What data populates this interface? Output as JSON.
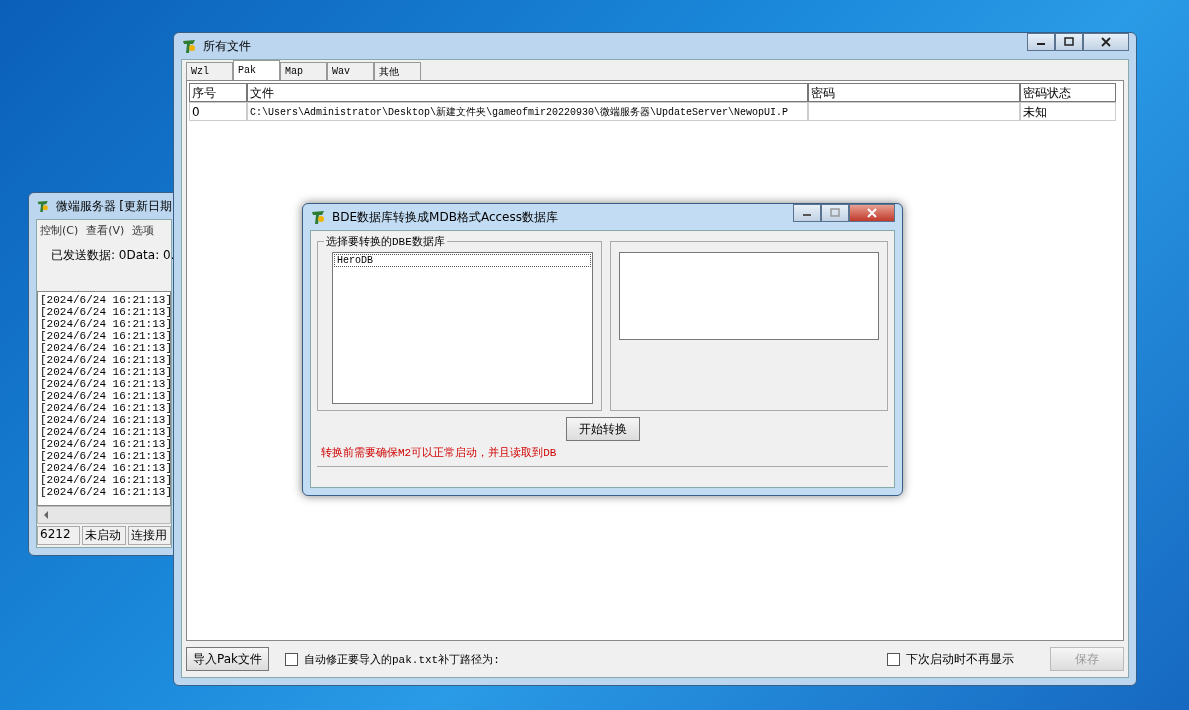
{
  "back_window": {
    "title": "微端服务器 [更新日期",
    "menu": [
      {
        "label": "控制(C)"
      },
      {
        "label": "查看(V)"
      },
      {
        "label": "选项"
      }
    ],
    "sent_data": "已发送数据: 0Data: 0.",
    "log": [
      "[2024/6/24 16:21:13]",
      "[2024/6/24 16:21:13]",
      "[2024/6/24 16:21:13]",
      "[2024/6/24 16:21:13]",
      "[2024/6/24 16:21:13]",
      "[2024/6/24 16:21:13]",
      "[2024/6/24 16:21:13]",
      "[2024/6/24 16:21:13]",
      "[2024/6/24 16:21:13]",
      "[2024/6/24 16:21:13]",
      "[2024/6/24 16:21:13]",
      "[2024/6/24 16:21:13]",
      "[2024/6/24 16:21:13]",
      "[2024/6/24 16:21:13]",
      "[2024/6/24 16:21:13]",
      "[2024/6/24 16:21:13]",
      "[2024/6/24 16:21:13]"
    ],
    "status": [
      "6212",
      "未启动",
      "连接用"
    ]
  },
  "main_window": {
    "title": "所有文件",
    "tabs": [
      {
        "label": "Wzl",
        "selected": false
      },
      {
        "label": "Pak",
        "selected": true
      },
      {
        "label": "Map",
        "selected": false
      },
      {
        "label": "Wav",
        "selected": false
      },
      {
        "label": "其他",
        "selected": false
      }
    ],
    "table": {
      "columns": [
        "序号",
        "文件",
        "密码",
        "密码状态"
      ],
      "rows": [
        {
          "index": "0",
          "file": "C:\\Users\\Administrator\\Desktop\\新建文件夹\\gameofmir20220930\\微端服务器\\UpdateServer\\NewopUI.P",
          "status": "未知"
        }
      ]
    },
    "import_button": "导入Pak文件",
    "auto_fix": {
      "label": "自动修正要导入的pak.txt补丁路径为:",
      "checked": false
    },
    "no_show": {
      "label": "下次启动时不再显示",
      "checked": false
    },
    "save_button": {
      "label": "保存",
      "disabled": true
    }
  },
  "dialog": {
    "title": "BDE数据库转换成MDB格式Access数据库",
    "group_label": "选择要转换的DBE数据库",
    "db_list": [
      {
        "label": "HeroDB",
        "selected": true
      }
    ],
    "convert_button": "开始转换",
    "note": "转换前需要确保M2可以正常启动，并且读取到DB"
  }
}
